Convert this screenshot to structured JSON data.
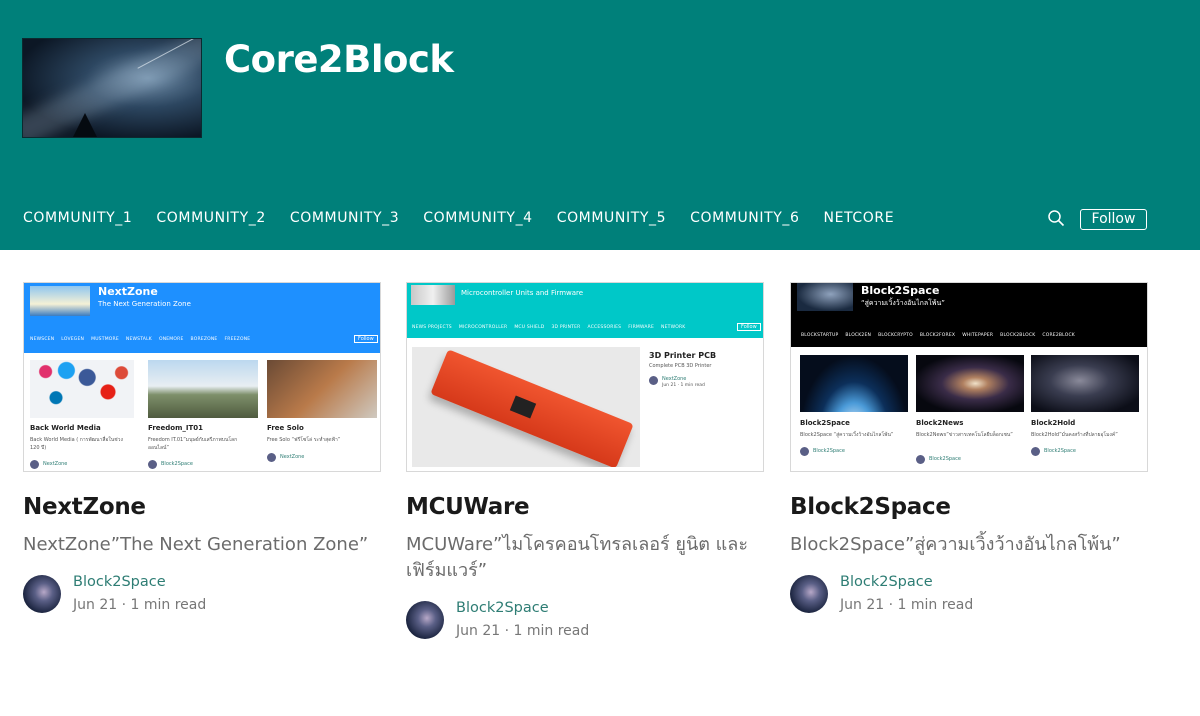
{
  "site": {
    "title": "Core2Block"
  },
  "nav": {
    "items": [
      "COMMUNITY_1",
      "COMMUNITY_2",
      "COMMUNITY_3",
      "COMMUNITY_4",
      "COMMUNITY_5",
      "COMMUNITY_6",
      "NETCORE"
    ],
    "follow_label": "Follow",
    "search_icon": "search-icon"
  },
  "colors": {
    "header": "#00807a",
    "author_link": "#2e7d74"
  },
  "cards": [
    {
      "title": "NextZone",
      "subtitle": "NextZone”The Next Generation Zone”",
      "author": "Block2Space",
      "date": "Jun 21",
      "read_time": "1 min read",
      "preview": {
        "title": "NextZone",
        "subtitle": "The Next Generation Zone",
        "nav": [
          "NEWSCEN",
          "LOVEGEN",
          "MUSTMORE",
          "NEWSTALK",
          "ONEMORE",
          "BOREZONE",
          "FREEZONE"
        ],
        "follow": "Follow",
        "posts": [
          {
            "title": "Back World Media",
            "text": "Back World Media ( การพัฒนาสื่อในช่วง 120 ปี)",
            "author": "NextZone"
          },
          {
            "title": "Freedom_IT01",
            "text": "Freedom IT.01”มนุษย์กับเสรีภาพบนโลกออนไลน์”",
            "author": "Block2Space"
          },
          {
            "title": "Free Solo",
            "text": "Free Solo “ฟรีโซโล่ ระห่ำสุดฟ้า”",
            "author": "NextZone"
          }
        ]
      }
    },
    {
      "title": "MCUWare",
      "subtitle": "MCUWare”ไมโครคอนโทรลเลอร์ ยูนิต และ เฟิร์มแวร์”",
      "author": "Block2Space",
      "date": "Jun 21",
      "read_time": "1 min read",
      "preview": {
        "subtitle": "Microcontroller Units and Firmware",
        "nav": [
          "NEWS PROJECTS",
          "MICROCONTROLLER",
          "MCU SHIELD",
          "3D PRINTER",
          "ACCESSORIES",
          "FIRMWARE",
          "NETWORK"
        ],
        "follow": "Follow",
        "post_title": "3D Printer PCB",
        "post_text": "Complete PCB 3D Printer",
        "post_author": "NextZone",
        "post_meta": "Jun 21 · 1 min read"
      }
    },
    {
      "title": "Block2Space",
      "subtitle": "Block2Space”สู่ความเวิ้งว้างอันไกลโพ้น”",
      "author": "Block2Space",
      "date": "Jun 21",
      "read_time": "1 min read",
      "preview": {
        "title": "Block2Space",
        "subtitle": "“สู่ความเวิ้งว้างอันไกลโพ้น”",
        "nav": [
          "BLOCKSTARTUP",
          "BLOCK2EN",
          "BLOCKCRYPTO",
          "BLOCK2FOREX",
          "WHITEPAPER",
          "BLOCK2BLOCK",
          "CORE2BLOCK"
        ],
        "posts": [
          {
            "title": "Block2Space",
            "text": "Block2Space “สู่ความเวิ้งว้างอันไกลโพ้น”",
            "author": "Block2Space"
          },
          {
            "title": "Block2News",
            "text": "Block2News”ข่าวสารเทคโนโลยีบล็อกเชน”",
            "author": "Block2Space"
          },
          {
            "title": "Block2Hold",
            "text": "Block2Hold”มั่นคงสร้างที่ปลายอุโมงค์”",
            "author": "Block2Space"
          }
        ]
      }
    }
  ],
  "separator": "·"
}
